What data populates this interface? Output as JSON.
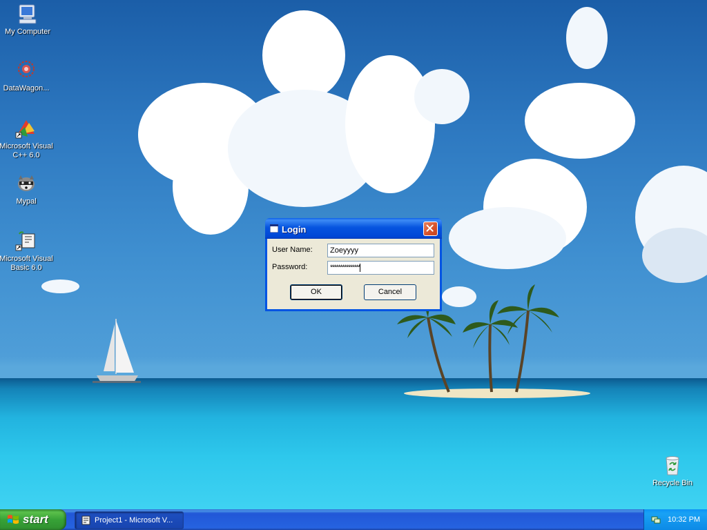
{
  "desktop": {
    "icons": [
      {
        "label": "My Computer",
        "icon": "my-computer-icon"
      },
      {
        "label": "DataWagon...",
        "icon": "datawagon-icon"
      },
      {
        "label": "Microsoft Visual C++ 6.0",
        "icon": "visual-cpp-icon"
      },
      {
        "label": "Mypal",
        "icon": "mypal-icon"
      },
      {
        "label": "Microsoft Visual Basic 6.0",
        "icon": "visual-basic-icon"
      },
      {
        "label": "Recycle Bin",
        "icon": "recycle-bin-icon"
      }
    ]
  },
  "dialog": {
    "title": "Login",
    "username_label": "User Name:",
    "username_value": "Zoeyyyy",
    "password_label": "Password:",
    "password_value": "***************",
    "ok_label": "OK",
    "cancel_label": "Cancel"
  },
  "taskbar": {
    "start_label": "start",
    "task_label": "Project1 - Microsoft V...",
    "clock": "10:32 PM"
  },
  "colors": {
    "taskbar_blue": "#2663e0",
    "start_green": "#37a237",
    "dialog_face": "#ece9d8",
    "close_red": "#d6512a"
  }
}
